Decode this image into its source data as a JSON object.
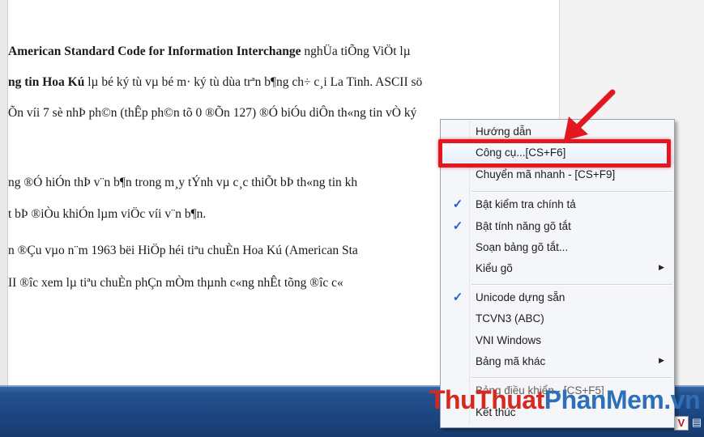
{
  "document": {
    "lines": [
      {
        "bold": "American Standard Code for Information Interchange",
        "rest": " nghÜa tiÕng ViÖt lµ"
      },
      {
        "bold": "ng tin Hoa Kú",
        "rest": " lµ bé ký tù vµ bé m· ký tù dùa trªn b¶ng ch÷ c¸i La Tinh. ASCII sö"
      },
      {
        "bold": "",
        "rest": "Õn víi 7 sè nhÞ ph©n (thÊp ph©n tõ 0 ®Õn 127) ®Ó biÓu diÔn th«ng tin vÒ ký"
      },
      {
        "bold": "",
        "rest": "ng ®Ó hiÓn thÞ v¨n b¶n trong m¸y tÝnh vµ c¸c thiÕt bÞ th«ng tin kh"
      },
      {
        "bold": "",
        "rest": "t bÞ ®iÒu khiÓn lµm viÖc víi v¨n b¶n."
      },
      {
        "bold": "",
        "rest": "n ®Çu vµo n¨m 1963 bëi HiÖp héi tiªu chuÈn Hoa Kú (American Sta"
      },
      {
        "bold": "",
        "rest": "II ®­îc xem lµ tiªu chuÈn phÇn mÒm thµnh c«ng nhÊt tõng ®­îc c«"
      }
    ]
  },
  "menu": {
    "items": [
      {
        "label": "Hướng dẫn",
        "checked": false,
        "submenu": false
      },
      {
        "label": "Công cụ...[CS+F6]",
        "checked": false,
        "submenu": false,
        "highlighted": true
      },
      {
        "label": "Chuyển mã nhanh - [CS+F9]",
        "checked": false,
        "submenu": false
      },
      {
        "label": "Bật kiểm tra chính tả",
        "checked": true,
        "submenu": false
      },
      {
        "label": "Bật tính năng gõ tắt",
        "checked": true,
        "submenu": false
      },
      {
        "label": "Soạn bảng gõ tắt...",
        "checked": false,
        "submenu": false
      },
      {
        "label": "Kiểu gõ",
        "checked": false,
        "submenu": true
      },
      {
        "label": "Unicode dựng sẵn",
        "checked": true,
        "submenu": false
      },
      {
        "label": "TCVN3 (ABC)",
        "checked": false,
        "submenu": false
      },
      {
        "label": "VNI Windows",
        "checked": false,
        "submenu": false
      },
      {
        "label": "Bảng mã khác",
        "checked": false,
        "submenu": true
      },
      {
        "label": "Bảng điều khiển - [CS+F5]",
        "checked": false,
        "submenu": false
      },
      {
        "label": "Kết thúc",
        "checked": false,
        "submenu": false
      }
    ],
    "check_glyph": "✓",
    "submenu_glyph": "▶"
  },
  "watermark": {
    "part1": "ThuThuat",
    "part2": "PhanMem",
    "part3": ".vn"
  },
  "tray": {
    "unikey_glyph": "V"
  },
  "colors": {
    "highlight_border": "#e2171f",
    "arrow": "#e2171f",
    "check": "#1e5fd6",
    "taskbar": "#1c4580"
  }
}
